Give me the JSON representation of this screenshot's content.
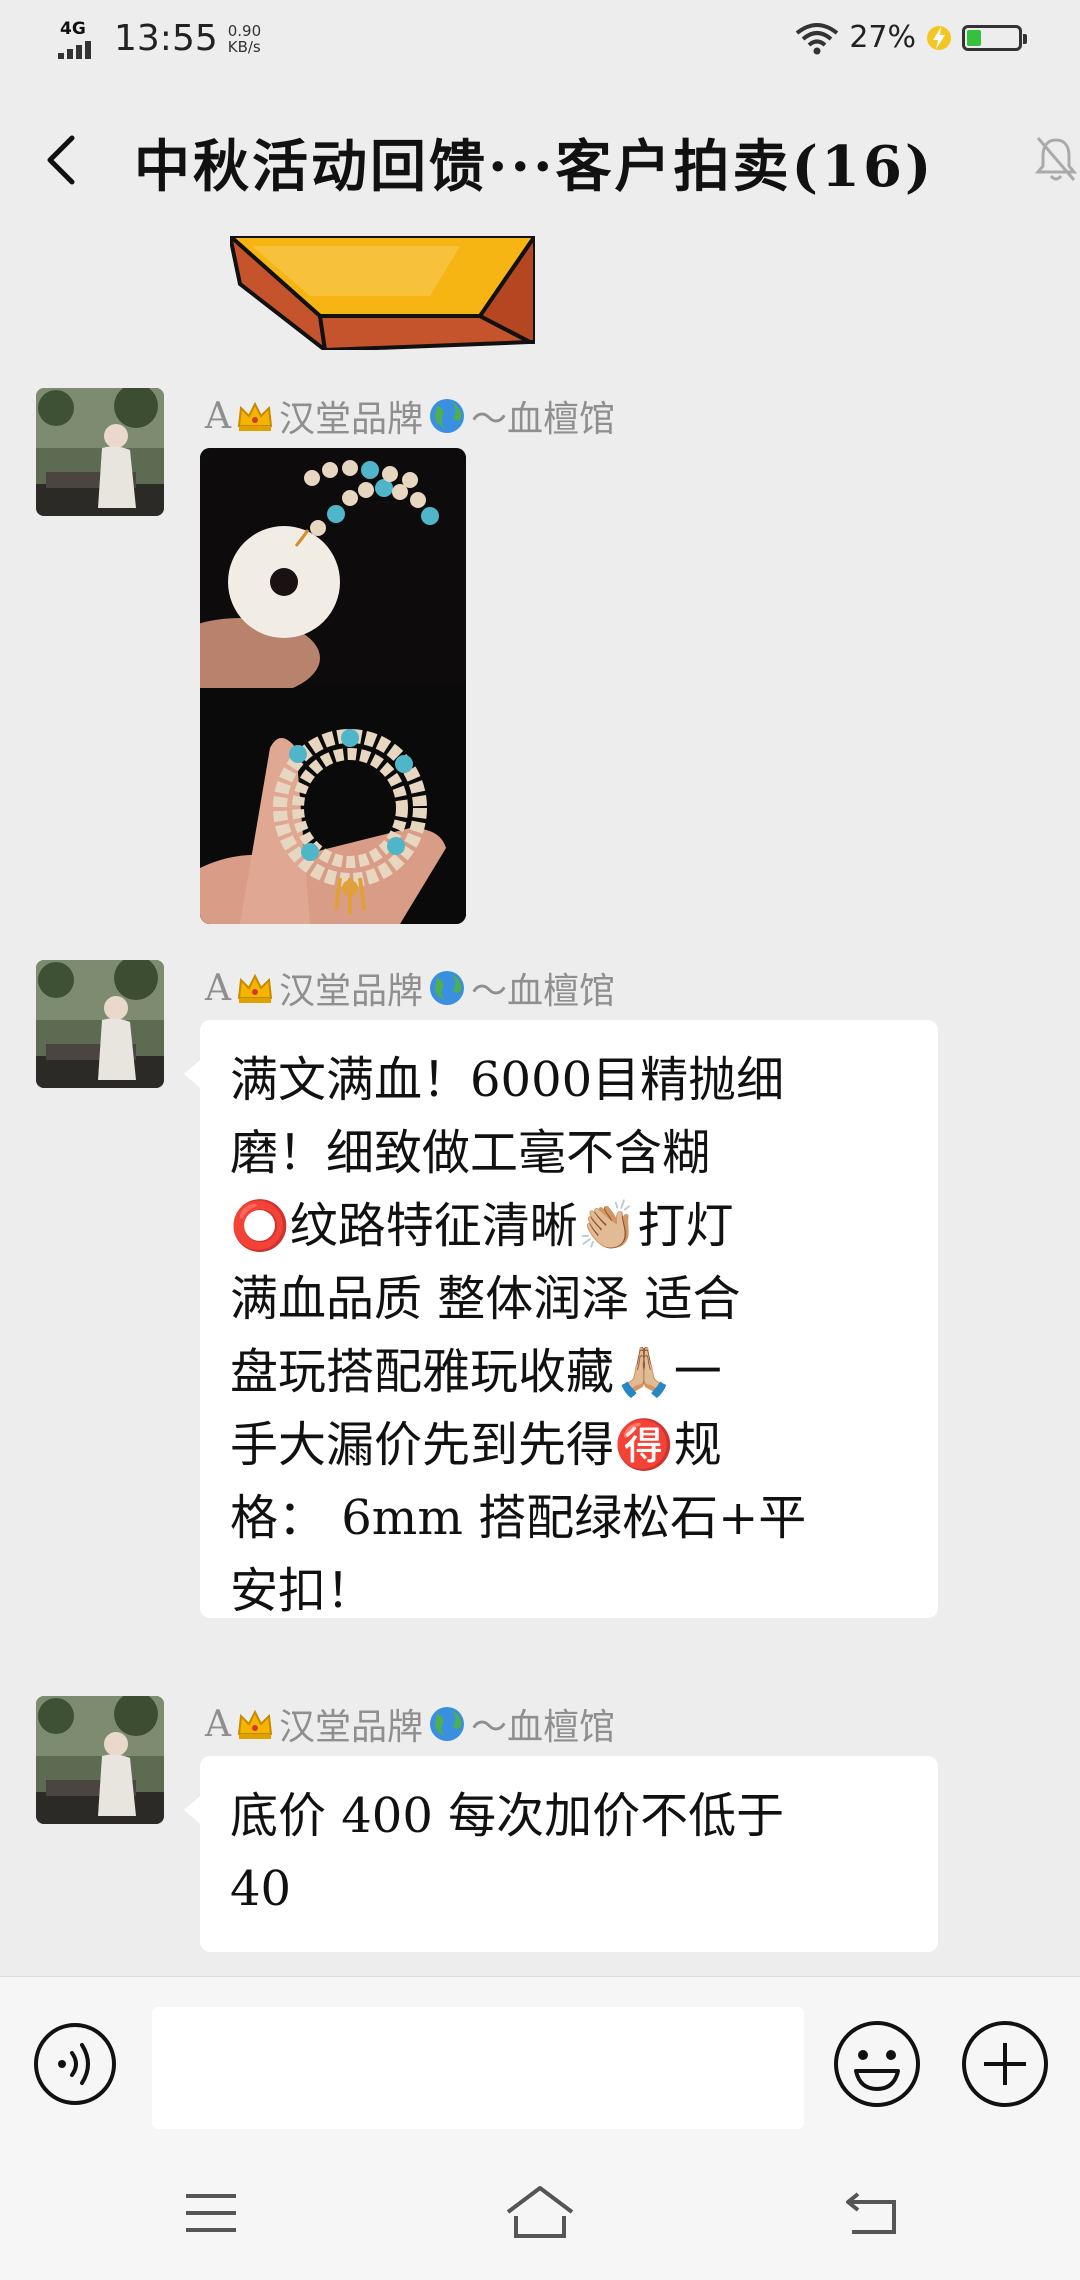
{
  "status_bar": {
    "network": "4G",
    "time": "13:55",
    "speed_value": "0.90",
    "speed_unit": "KB/s",
    "battery_percent": "27%",
    "battery_level": 0.27,
    "battery_color": "#35c13e"
  },
  "header": {
    "title": "中秋活动回馈···客户拍卖(16)",
    "back_icon": "chevron-left-icon",
    "mute_icon": "bell-off-icon"
  },
  "messages": [
    {
      "sender_prefix": "A",
      "sender_emoji_1": "crown-icon",
      "sender_middle": "汉堂品牌",
      "sender_emoji_2": "globe-icon",
      "sender_suffix": "～血檀馆",
      "type": "image"
    },
    {
      "sender_prefix": "A",
      "sender_emoji_1": "crown-icon",
      "sender_middle": "汉堂品牌",
      "sender_emoji_2": "globe-icon",
      "sender_suffix": "～血檀馆",
      "type": "text",
      "lines": [
        "满文满血！6000目精抛细",
        "磨！细致做工毫不含糊",
        "⭕纹路特征清晰👏🏼打灯",
        "满血品质 整体润泽 适合",
        "盘玩搭配雅玩收藏🙏🏼一",
        "手大漏价先到先得🉐规",
        "格： 6mm 搭配绿松石+平",
        "安扣！"
      ]
    },
    {
      "sender_prefix": "A",
      "sender_emoji_1": "crown-icon",
      "sender_middle": "汉堂品牌",
      "sender_emoji_2": "globe-icon",
      "sender_suffix": "～血檀馆",
      "type": "text",
      "lines": [
        "底价 400 每次加价不低于",
        "40"
      ]
    }
  ],
  "input_bar": {
    "value": "",
    "voice_icon": "voice-icon",
    "emoji_icon": "smiley-icon",
    "plus_icon": "plus-icon"
  },
  "nav_bar": {
    "menu_icon": "menu-icon",
    "home_icon": "home-icon",
    "back_icon": "back-arrow-icon"
  }
}
